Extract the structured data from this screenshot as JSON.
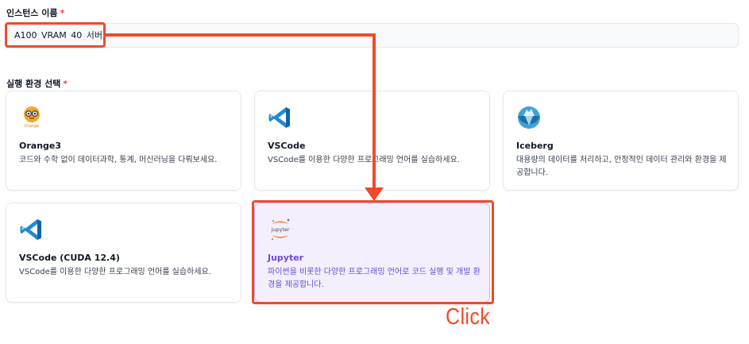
{
  "form": {
    "instance_name_label": "인스턴스 이름",
    "required_mark": "*",
    "instance_name_value": "A100_VRAM_40_서버",
    "env_label": "실행 환경 선택"
  },
  "environments": [
    {
      "title": "Orange3",
      "description": "코드와 수학 없이 데이터과학, 통계, 머신러닝을 다뤄보세요.",
      "icon": "orange3-logo-icon",
      "logo_text": "Orange"
    },
    {
      "title": "VSCode",
      "description": "VSCode를 이용한 다양한 프로그래밍 언어를 실습하세요.",
      "icon": "vscode-icon"
    },
    {
      "title": "Iceberg",
      "description": "대용량의 데이터를 처리하고, 안정적인 데이터 관리와 환경을 제공합니다.",
      "icon": "iceberg-icon"
    },
    {
      "title": "VSCode (CUDA 12.4)",
      "description": "VSCode를 이용한 다양한 프로그래밍 언어를 실습하세요.",
      "icon": "vscode-icon"
    },
    {
      "title": "Jupyter",
      "description": "파이썬을 비롯한 다양한 프로그래밍 언어로 코드 실행 및 개발 환경을 제공합니다.",
      "icon": "jupyter-logo-icon",
      "logo_text": "jupyter",
      "selected": true
    }
  ],
  "annotation": {
    "click_label": "Click",
    "color": "#f04a2a"
  },
  "colors": {
    "selected_bg": "#f3effc",
    "selected_text": "#6d4bd8",
    "required": "#ef4444"
  }
}
